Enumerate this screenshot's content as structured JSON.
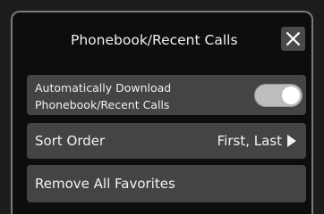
{
  "header": {
    "title": "Phonebook/Recent Calls",
    "close_icon": "close-icon"
  },
  "settings": {
    "auto_download": {
      "label": "Automatically Download\nPhonebook/Recent Calls",
      "enabled": true
    },
    "sort_order": {
      "label": "Sort Order",
      "value": "First, Last",
      "icon": "chevron-right-icon"
    },
    "remove_favorites": {
      "label": "Remove All Favorites"
    }
  },
  "colors": {
    "background": "#0d0d0d",
    "row": "#444444",
    "toggle_on": "#bdbdbd",
    "text": "#f2f2f2"
  }
}
